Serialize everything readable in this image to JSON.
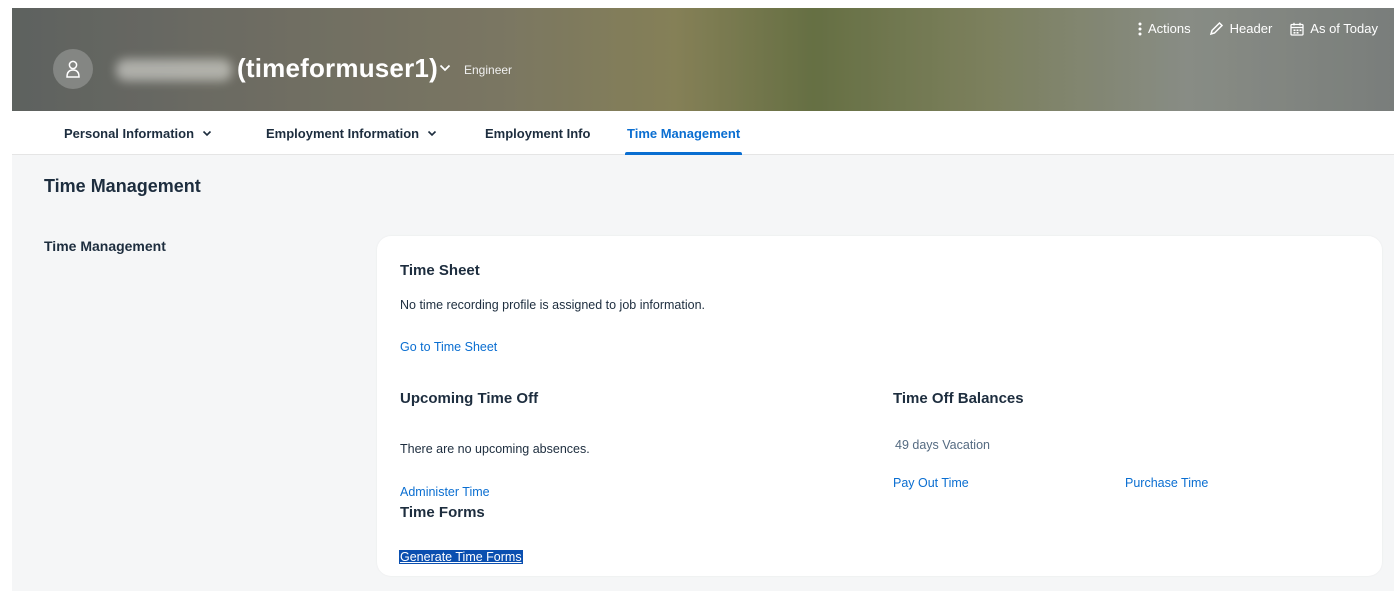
{
  "header": {
    "user_id": "(timeformuser1)",
    "job_title": "Engineer",
    "actions": [
      {
        "label": "Actions",
        "icon": "more-vertical-icon"
      },
      {
        "label": "Header",
        "icon": "pencil-icon"
      },
      {
        "label": "As of Today",
        "icon": "calendar-icon"
      }
    ]
  },
  "tabs": [
    {
      "label": "Personal Information",
      "has_dropdown": true
    },
    {
      "label": "Employment Information",
      "has_dropdown": true
    },
    {
      "label": "Employment Info",
      "has_dropdown": false
    },
    {
      "label": "Time Management",
      "has_dropdown": false,
      "active": true
    }
  ],
  "page": {
    "section_title": "Time Management",
    "sub_title": "Time Management"
  },
  "card": {
    "time_sheet": {
      "title": "Time Sheet",
      "message": "No time recording profile is assigned to job information.",
      "link": "Go to Time Sheet"
    },
    "upcoming": {
      "title": "Upcoming Time Off",
      "message": "There are no upcoming absences.",
      "link": "Administer Time"
    },
    "balances": {
      "title": "Time Off Balances",
      "value": "49 days Vacation",
      "pay_out": "Pay Out Time",
      "purchase": "Purchase Time"
    },
    "forms": {
      "title": "Time Forms",
      "link": "Generate Time Forms"
    }
  },
  "colors": {
    "accent": "#0a6ed1",
    "text": "#1d2d3e",
    "background": "#f5f6f7"
  }
}
